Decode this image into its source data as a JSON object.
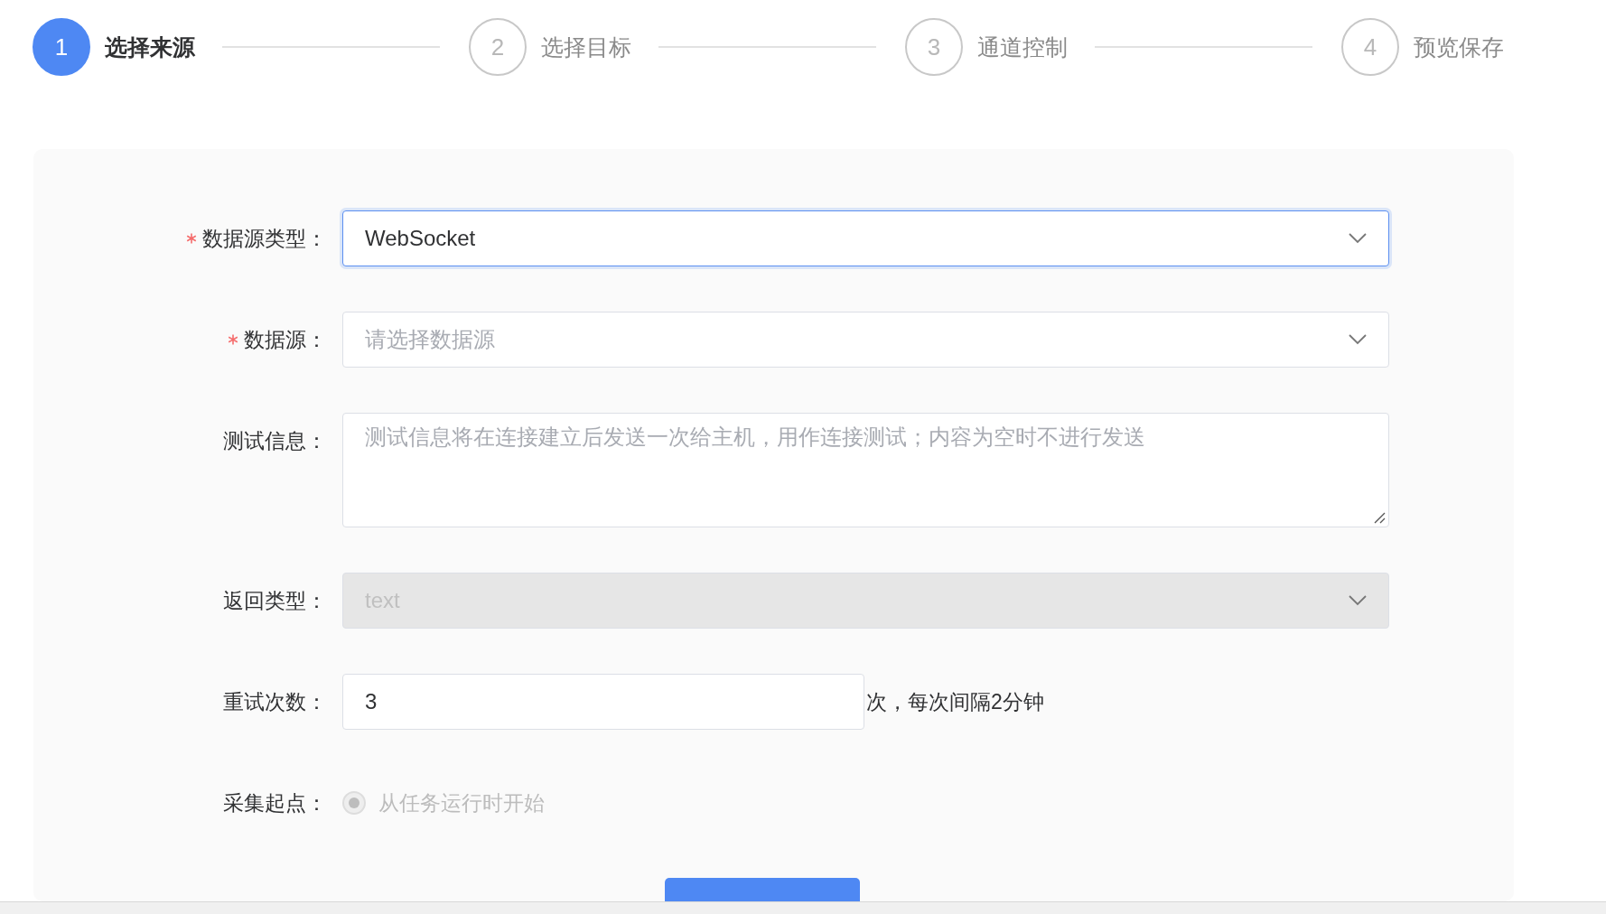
{
  "steps": [
    {
      "number": "1",
      "label": "选择来源",
      "selected": true
    },
    {
      "number": "2",
      "label": "选择目标",
      "selected": false
    },
    {
      "number": "3",
      "label": "通道控制",
      "selected": false
    },
    {
      "number": "4",
      "label": "预览保存",
      "selected": false
    }
  ],
  "form": {
    "fields": [
      {
        "kind": "select",
        "label": "数据源类型：",
        "required": true,
        "value": "WebSocket",
        "focused": true,
        "disabled": false
      },
      {
        "kind": "select",
        "label": "数据源：",
        "required": true,
        "placeholder": "请选择数据源",
        "focused": false,
        "disabled": false
      },
      {
        "kind": "textarea",
        "label": "测试信息：",
        "required": false,
        "placeholder": "测试信息将在连接建立后发送一次给主机，用作连接测试；内容为空时不进行发送"
      },
      {
        "kind": "select",
        "label": "返回类型：",
        "required": false,
        "value": "text",
        "focused": false,
        "disabled": true
      },
      {
        "kind": "number",
        "label": "重试次数：",
        "required": false,
        "value": "3",
        "suffix": "次，每次间隔2分钟"
      },
      {
        "kind": "radio",
        "label": "采集起点：",
        "required": false,
        "options": [
          {
            "label": "从任务运行时开始",
            "selected": true,
            "disabled": true
          }
        ]
      }
    ]
  }
}
